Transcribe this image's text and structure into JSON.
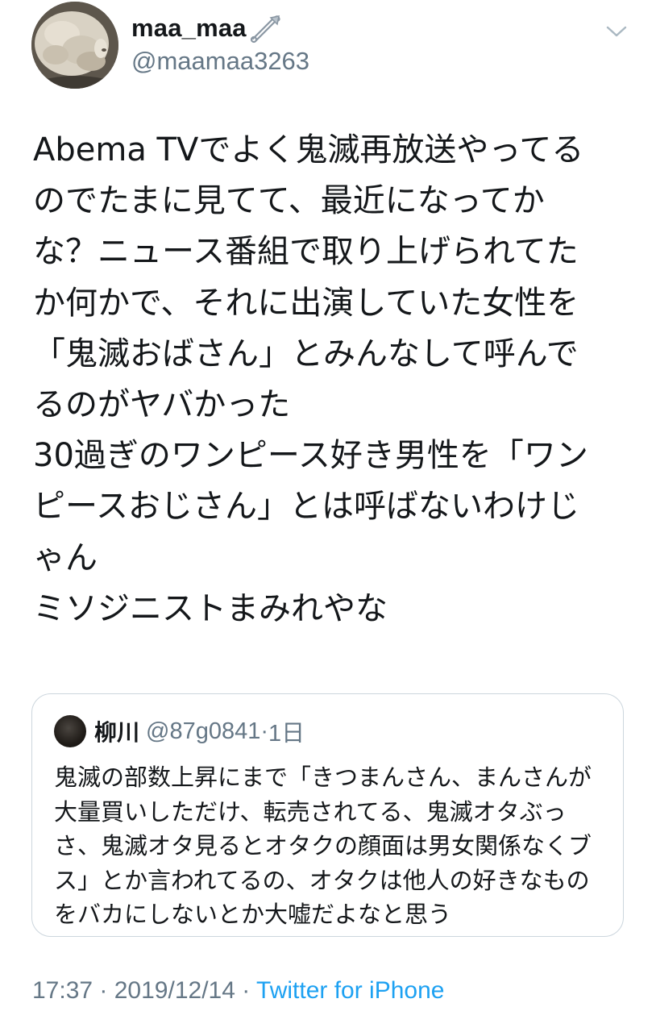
{
  "author": {
    "display_name": "maa_maa",
    "handle": "@maamaa3263",
    "badge_icon": "safety-pin-icon",
    "avatar_icon": "sheep-avatar"
  },
  "menu": {
    "icon": "chevron-down-icon"
  },
  "tweet": {
    "lines": [
      "Abema TVでよく鬼滅再放送やってる",
      "のでたまに見てて、最近になってか",
      "な？ニュース番組で取り上げられてた",
      "か何かで、それに出演していた女性を",
      "「鬼滅おばさん」とみんなして呼んで",
      "るのがヤバかった",
      "30過ぎのワンピース好き男性を「ワン",
      "ピースおじさん」とは呼ばないわけじ",
      "ゃん",
      "ミソジニストまみれやな"
    ]
  },
  "quote": {
    "name": "柳川",
    "handle": "@87g0841",
    "separator": "·",
    "age": "1日",
    "lines": [
      "鬼滅の部数上昇にまで「きつまんさん、まんさんが",
      "大量買いしただけ、転売されてる、鬼滅オタぶっ",
      "さ、鬼滅オタ見るとオタクの顔面は男女関係なくブ",
      "ス」とか言われてるの、オタクは他人の好きなもの",
      "をバカにしないとか大嘘だよなと思う"
    ]
  },
  "footer": {
    "time": "17:37",
    "separator": " · ",
    "date": "2019/12/14",
    "source": "Twitter for iPhone"
  },
  "colors": {
    "text": "#14171a",
    "secondary": "#657786",
    "link": "#1da1f2",
    "border": "#ccd6dd"
  }
}
